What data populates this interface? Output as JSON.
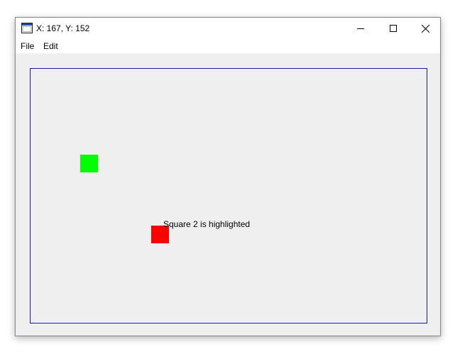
{
  "window": {
    "title": "X: 167, Y: 152",
    "icon": "app-window-icon",
    "controls": {
      "minimize_icon": "minimize-icon",
      "maximize_icon": "maximize-icon",
      "close_icon": "close-icon"
    }
  },
  "menu": {
    "items": [
      {
        "label": "File"
      },
      {
        "label": "Edit"
      }
    ]
  },
  "canvas": {
    "border_color": "#1a1aa8",
    "background": "#efefef",
    "squares": [
      {
        "color": "#00ff00"
      },
      {
        "color": "#ff0000"
      }
    ],
    "status": "Square 2 is highlighted"
  }
}
